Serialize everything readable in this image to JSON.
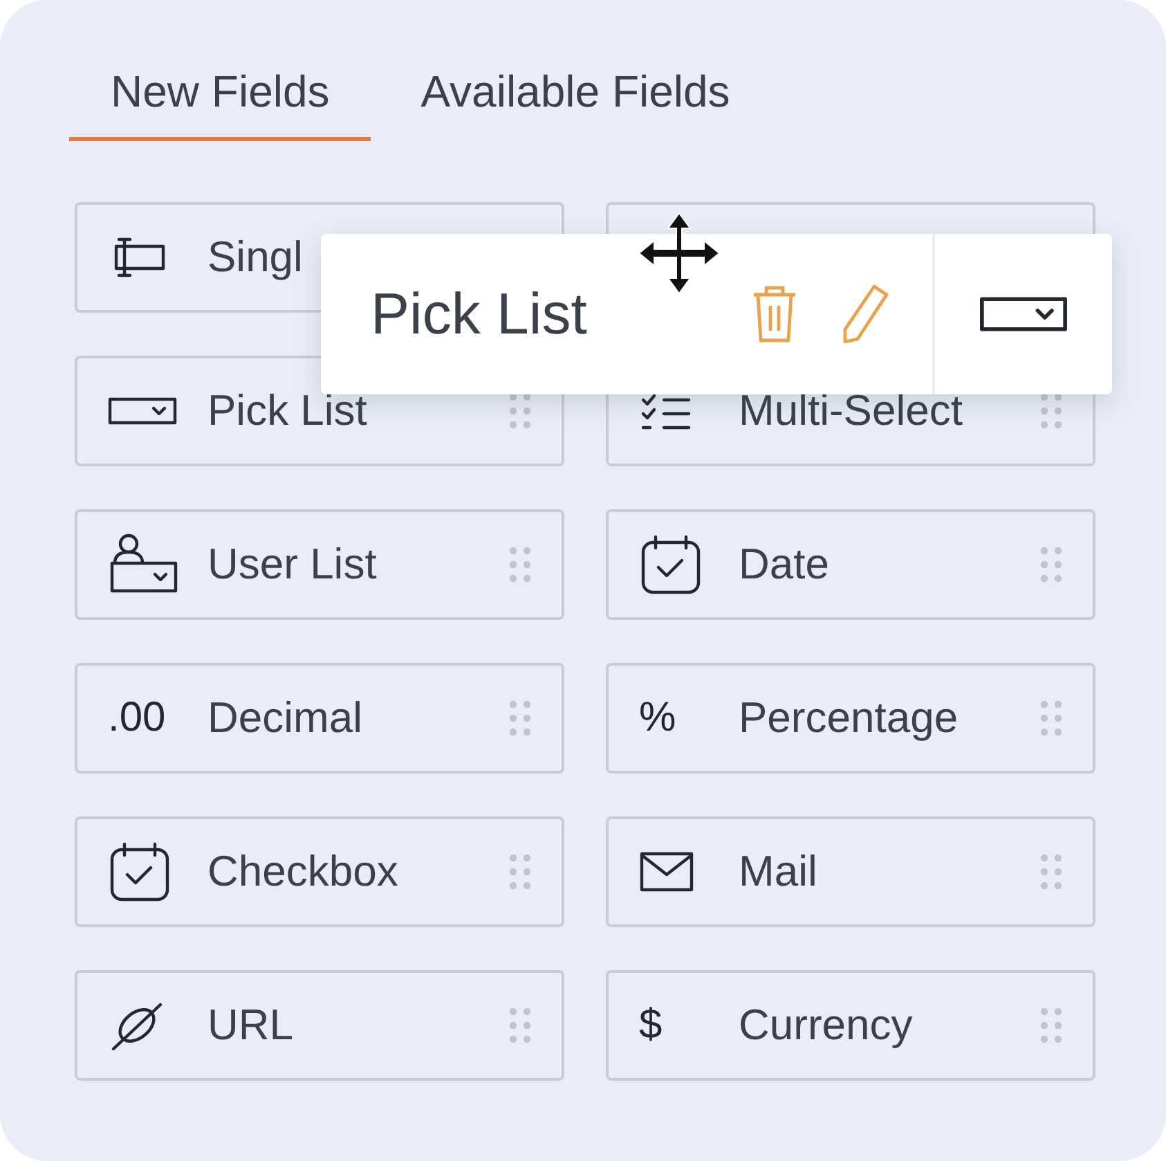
{
  "tabs": [
    {
      "label": "New Fields",
      "selected": true
    },
    {
      "label": "Available Fields",
      "selected": false
    }
  ],
  "fields": [
    {
      "kind": "textbox",
      "label": "Singl"
    },
    {
      "kind": "covered"
    },
    {
      "kind": "picklist",
      "label": "Pick List"
    },
    {
      "kind": "multiselect",
      "label": "Multi-Select"
    },
    {
      "kind": "userlist",
      "label": "User List"
    },
    {
      "kind": "calendar",
      "label": "Date"
    },
    {
      "kind": "glyph",
      "glyph": ".00",
      "label": "Decimal"
    },
    {
      "kind": "glyph",
      "glyph": "%",
      "label": "Percentage"
    },
    {
      "kind": "calendar",
      "label": "Checkbox"
    },
    {
      "kind": "mail",
      "label": "Mail"
    },
    {
      "kind": "link",
      "label": "URL"
    },
    {
      "kind": "glyph",
      "glyph": "$",
      "label": "Currency"
    }
  ],
  "drag_preview": {
    "label": "Pick List",
    "kind": "picklist"
  }
}
